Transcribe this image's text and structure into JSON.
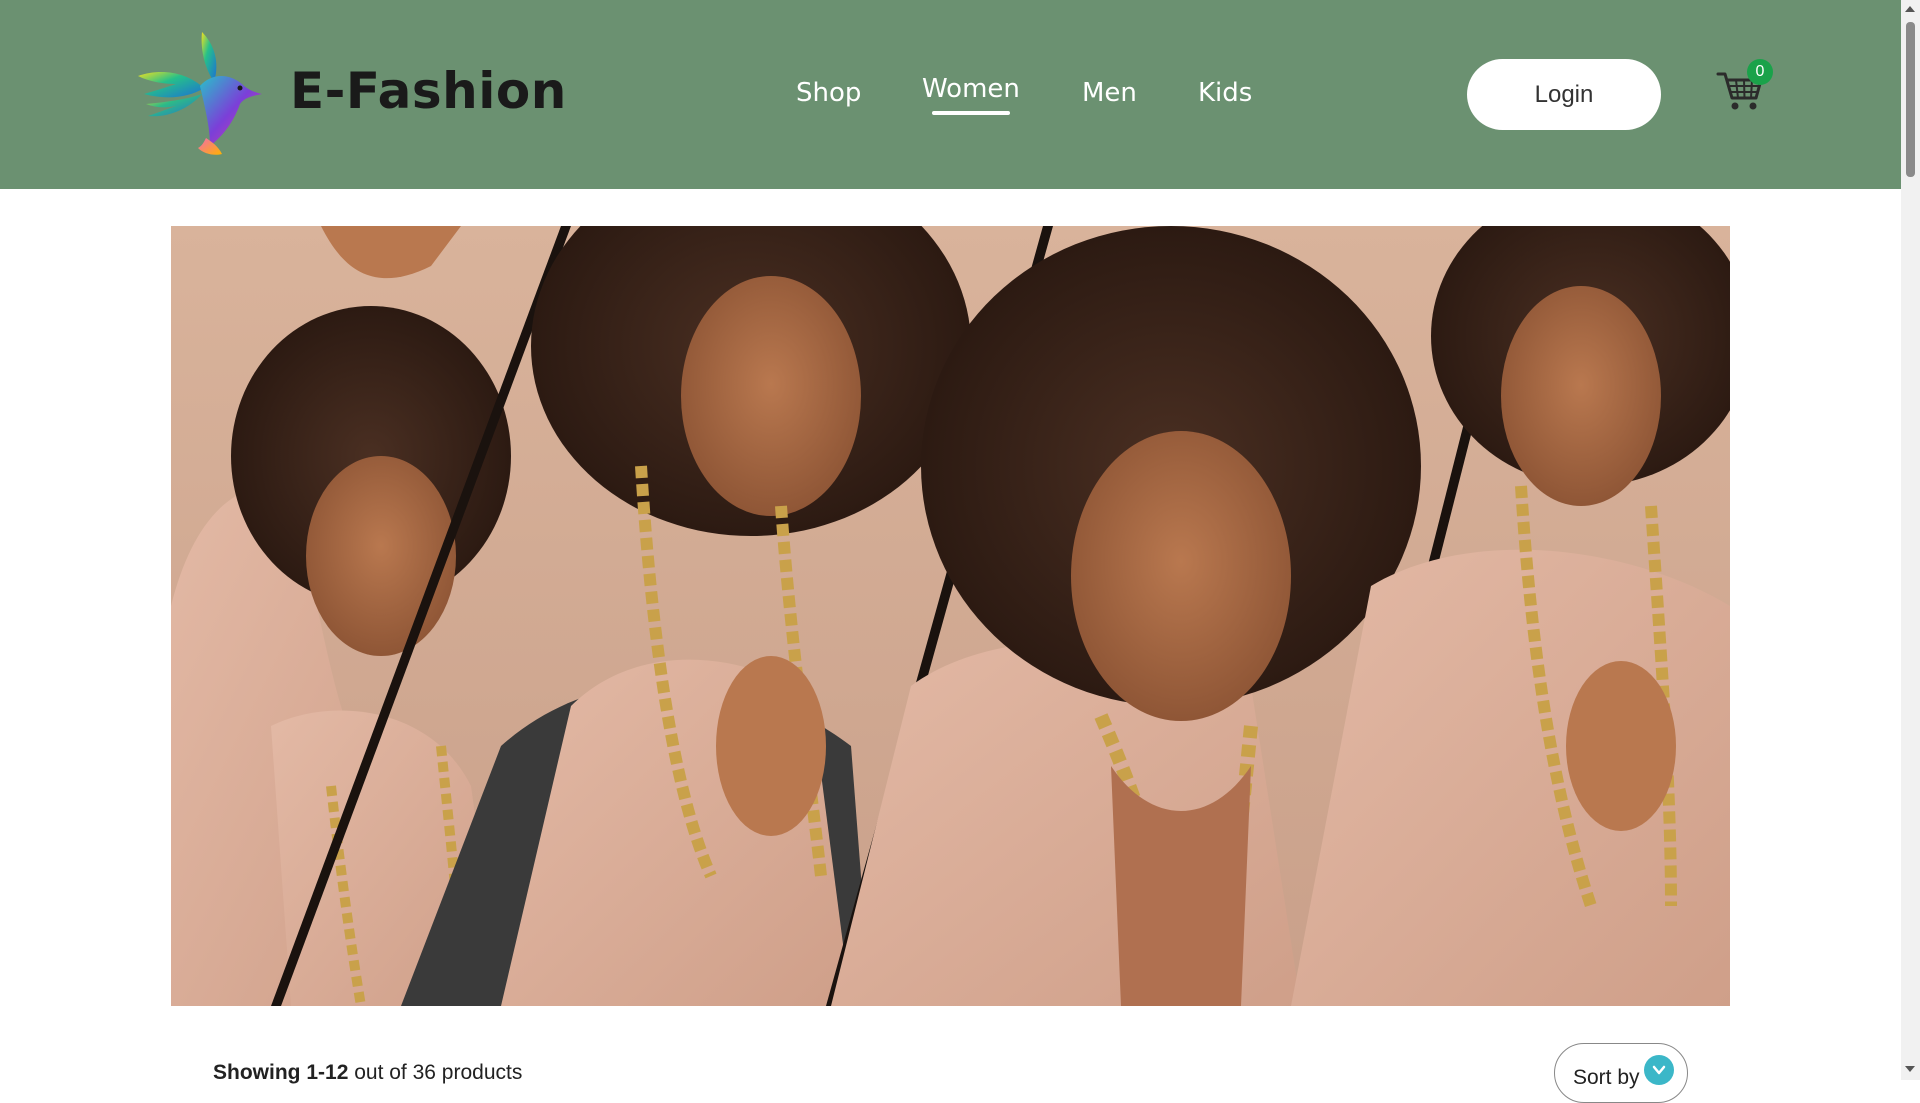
{
  "header": {
    "brand": "E-Fashion",
    "nav": [
      {
        "label": "Shop",
        "active": false
      },
      {
        "label": "Women",
        "active": true
      },
      {
        "label": "Men",
        "active": false
      },
      {
        "label": "Kids",
        "active": false
      }
    ],
    "login_label": "Login",
    "cart_count": "0",
    "colors": {
      "header_bg": "#6b9171",
      "badge": "#1aa24a"
    }
  },
  "icons": {
    "logo": "hummingbird-logo-icon",
    "cart": "shopping-cart-icon",
    "sort": "chevron-down-icon"
  },
  "products": {
    "showing_prefix": "Showing",
    "showing_range": "1-12",
    "showing_suffix": "out of 36 products",
    "sort_label": "Sort by"
  }
}
